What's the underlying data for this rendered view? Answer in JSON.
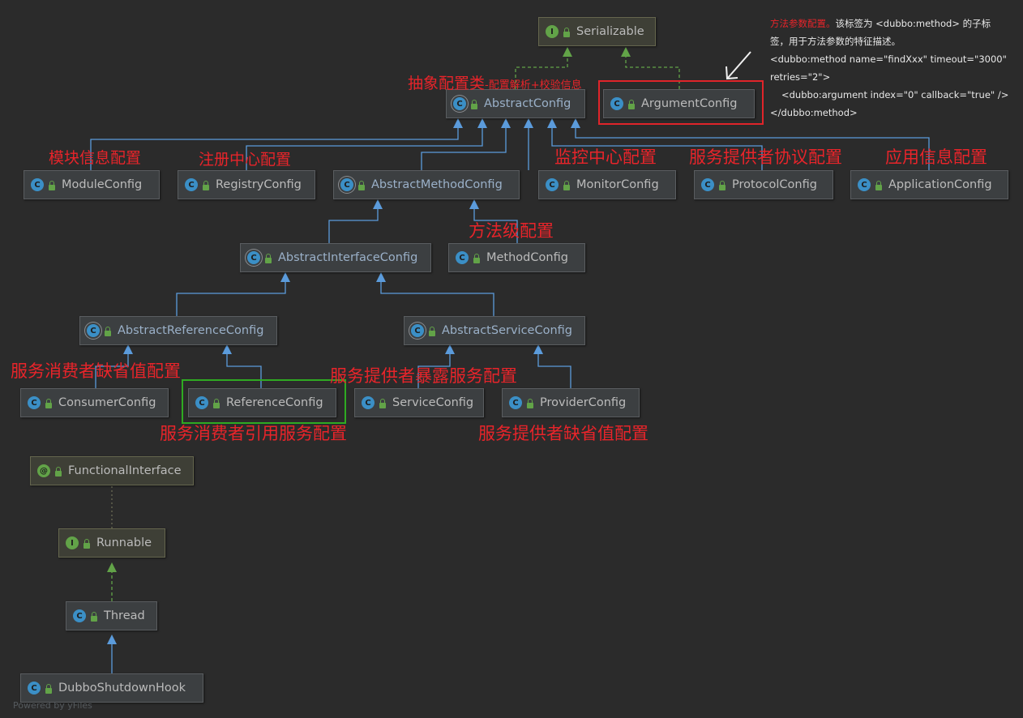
{
  "nodes": {
    "serializable": {
      "kind": "I",
      "label": "Serializable"
    },
    "abstract_config": {
      "kind": "C",
      "label": "AbstractConfig"
    },
    "argument_config": {
      "kind": "C",
      "label": "ArgumentConfig"
    },
    "module_config": {
      "kind": "C",
      "label": "ModuleConfig"
    },
    "registry_config": {
      "kind": "C",
      "label": "RegistryConfig"
    },
    "abstract_method_config": {
      "kind": "C",
      "label": "AbstractMethodConfig"
    },
    "monitor_config": {
      "kind": "C",
      "label": "MonitorConfig"
    },
    "protocol_config": {
      "kind": "C",
      "label": "ProtocolConfig"
    },
    "application_config": {
      "kind": "C",
      "label": "ApplicationConfig"
    },
    "abstract_interface_config": {
      "kind": "C",
      "label": "AbstractInterfaceConfig"
    },
    "method_config": {
      "kind": "C",
      "label": "MethodConfig"
    },
    "abstract_reference_config": {
      "kind": "C",
      "label": "AbstractReferenceConfig"
    },
    "abstract_service_config": {
      "kind": "C",
      "label": "AbstractServiceConfig"
    },
    "consumer_config": {
      "kind": "C",
      "label": "ConsumerConfig"
    },
    "reference_config": {
      "kind": "C",
      "label": "ReferenceConfig"
    },
    "service_config": {
      "kind": "C",
      "label": "ServiceConfig"
    },
    "provider_config": {
      "kind": "C",
      "label": "ProviderConfig"
    },
    "functional_interface": {
      "kind": "@",
      "label": "FunctionalInterface"
    },
    "runnable": {
      "kind": "I",
      "label": "Runnable"
    },
    "thread": {
      "kind": "C",
      "label": "Thread"
    },
    "dubbo_shutdown_hook": {
      "kind": "C",
      "label": "DubboShutdownHook"
    }
  },
  "annotations": {
    "abstract_config_main": "抽象配置类",
    "abstract_config_sub": "-配置解析+校验信息",
    "module": "模块信息配置",
    "registry": "注册中心配置",
    "monitor": "监控中心配置",
    "protocol": "服务提供者协议配置",
    "application": "应用信息配置",
    "method": "方法级配置",
    "consumer": "服务消费者缺省值配置",
    "service": "服务提供者暴露服务配置",
    "reference": "服务消费者引用服务配置",
    "provider": "服务提供者缺省值配置"
  },
  "info_note": {
    "title_red": "方法参数配置。",
    "line1_rest": "该标签为 <dubbo:method> 的子标",
    "line2": "签，用于方法参数的特征描述。",
    "line3": "<dubbo:method name=\"findXxx\" timeout=\"3000\"",
    "line4": "retries=\"2\">",
    "line5": "<dubbo:argument index=\"0\" callback=\"true\" />",
    "line6": "</dubbo:method>"
  },
  "footer": "Powered by yFiles",
  "colors": {
    "background": "#2b2b2b",
    "node": "#3c3f41",
    "extends_arrow": "#5b9bdb",
    "implements_arrow": "#62a348",
    "annotation": "#e8242a",
    "highlight_red": "#e0242a",
    "highlight_green": "#2faa22"
  }
}
